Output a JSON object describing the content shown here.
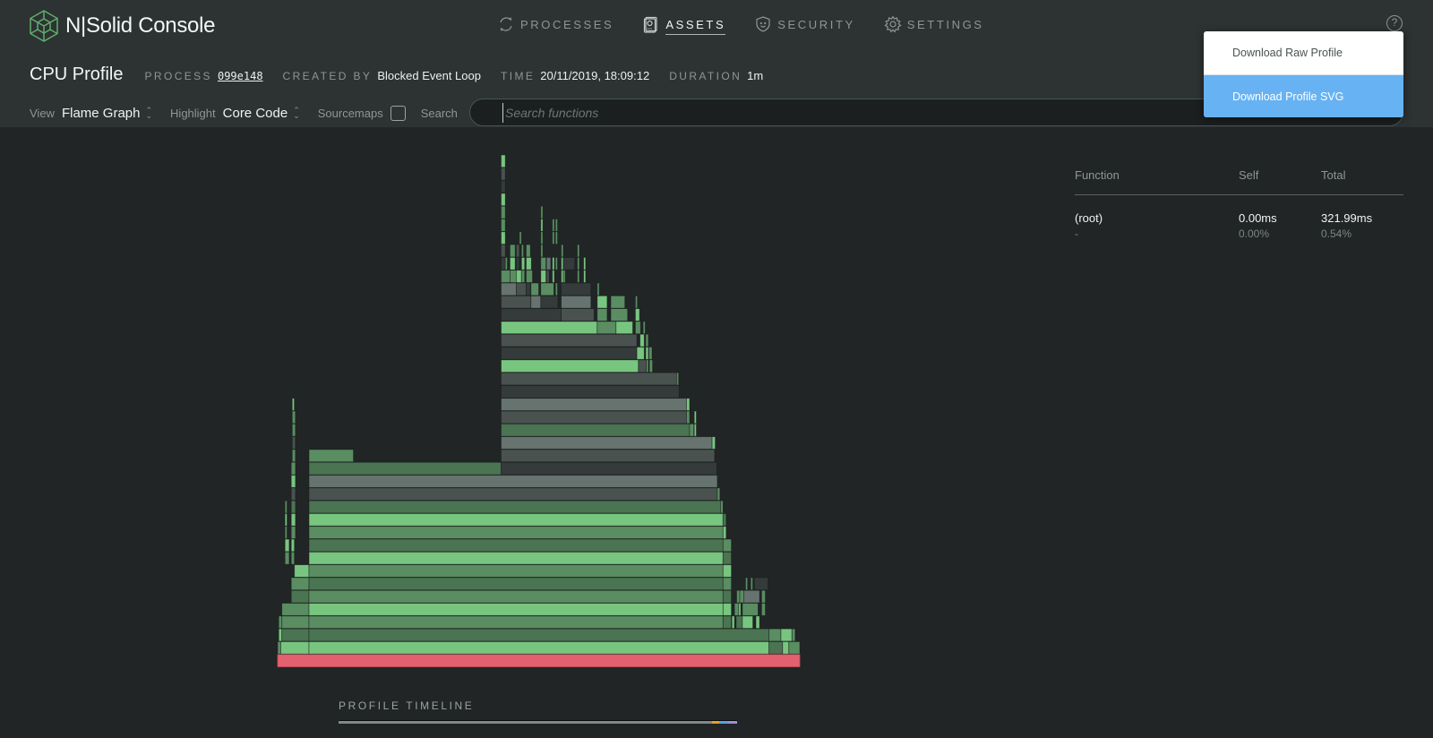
{
  "app": {
    "title": "N|Solid Console"
  },
  "nav": [
    {
      "label": "PROCESSES",
      "icon": "refresh-icon",
      "active": false
    },
    {
      "label": "ASSETS",
      "icon": "assets-icon",
      "active": true
    },
    {
      "label": "SECURITY",
      "icon": "shield-icon",
      "active": false
    },
    {
      "label": "SETTINGS",
      "icon": "gear-icon",
      "active": false
    }
  ],
  "help": {
    "glyph": "?"
  },
  "profile": {
    "title": "CPU Profile",
    "process_label": "PROCESS",
    "process_id": "099e148",
    "created_by_label": "CREATED BY",
    "created_by": "Blocked Event Loop",
    "time_label": "TIME",
    "time": "20/11/2019, 18:09:12",
    "duration_label": "DURATION",
    "duration": "1m"
  },
  "toolbar": {
    "view_label": "View",
    "view_value": "Flame Graph",
    "highlight_label": "Highlight",
    "highlight_value": "Core Code",
    "sourcemaps_label": "Sourcemaps",
    "sourcemaps_checked": false,
    "search_label": "Search",
    "search_placeholder": "Search functions",
    "search_value": ""
  },
  "download_menu": {
    "items": [
      {
        "label": "Download Raw Profile",
        "highlighted": false
      },
      {
        "label": "Download Profile SVG",
        "highlighted": true
      }
    ]
  },
  "function_table": {
    "headers": {
      "function": "Function",
      "self": "Self",
      "total": "Total"
    },
    "rows": [
      {
        "function": "(root)",
        "location": "-",
        "self_time": "0.00ms",
        "self_pct": "0.00%",
        "total_time": "321.99ms",
        "total_pct": "0.54%"
      }
    ]
  },
  "timeline": {
    "label": "PROFILE TIMELINE",
    "segments": [
      {
        "from": 0.0,
        "to": 0.936,
        "color": "#7f8a88"
      },
      {
        "from": 0.936,
        "to": 0.955,
        "color": "#e0a030"
      },
      {
        "from": 0.955,
        "to": 0.978,
        "color": "#5aa0e6"
      },
      {
        "from": 0.978,
        "to": 1.0,
        "color": "#a08cd0"
      }
    ]
  },
  "flame_colors": {
    "root": "#e2616f",
    "light": "#78c57f",
    "mid": "#5a8d62",
    "dark": "#4b7452",
    "gray-light": "#66736f",
    "gray": "#4a5250",
    "gray-dark": "#353b3b"
  },
  "flame_frames": [
    {
      "d": 0,
      "s": 0.0,
      "w": 1.0,
      "c": "root"
    },
    {
      "d": 1,
      "s": 0.0,
      "w": 0.006,
      "c": "mid"
    },
    {
      "d": 1,
      "s": 0.006,
      "w": 0.054,
      "c": "light"
    },
    {
      "d": 1,
      "s": 0.06,
      "w": 0.881,
      "c": "light"
    },
    {
      "d": 1,
      "s": 0.941,
      "w": 0.026,
      "c": "dark"
    },
    {
      "d": 1,
      "s": 0.967,
      "w": 0.012,
      "c": "light"
    },
    {
      "d": 1,
      "s": 0.979,
      "w": 0.021,
      "c": "mid"
    },
    {
      "d": 2,
      "s": 0.002,
      "w": 0.006,
      "c": "light"
    },
    {
      "d": 2,
      "s": 0.008,
      "w": 0.052,
      "c": "dark"
    },
    {
      "d": 2,
      "s": 0.06,
      "w": 0.881,
      "c": "dark"
    },
    {
      "d": 2,
      "s": 0.941,
      "w": 0.023,
      "c": "mid"
    },
    {
      "d": 2,
      "s": 0.964,
      "w": 0.021,
      "c": "light"
    },
    {
      "d": 2,
      "s": 0.985,
      "w": 0.006,
      "c": "mid"
    },
    {
      "d": 3,
      "s": 0.002,
      "w": 0.006,
      "c": "mid"
    },
    {
      "d": 3,
      "s": 0.008,
      "w": 0.052,
      "c": "mid"
    },
    {
      "d": 3,
      "s": 0.06,
      "w": 0.793,
      "c": "mid"
    },
    {
      "d": 3,
      "s": 0.853,
      "w": 0.016,
      "c": "dark"
    },
    {
      "d": 3,
      "s": 0.87,
      "w": 0.005,
      "c": "light"
    },
    {
      "d": 3,
      "s": 0.878,
      "w": 0.012,
      "c": "dark"
    },
    {
      "d": 3,
      "s": 0.89,
      "w": 0.02,
      "c": "light"
    },
    {
      "d": 3,
      "s": 0.916,
      "w": 0.007,
      "c": "light"
    },
    {
      "d": 4,
      "s": 0.008,
      "w": 0.052,
      "c": "mid"
    },
    {
      "d": 4,
      "s": 0.06,
      "w": 0.793,
      "c": "light"
    },
    {
      "d": 4,
      "s": 0.853,
      "w": 0.016,
      "c": "light"
    },
    {
      "d": 4,
      "s": 0.875,
      "w": 0.008,
      "c": "mid"
    },
    {
      "d": 4,
      "s": 0.883,
      "w": 0.004,
      "c": "light"
    },
    {
      "d": 4,
      "s": 0.89,
      "w": 0.03,
      "c": "mid"
    },
    {
      "d": 4,
      "s": 0.927,
      "w": 0.007,
      "c": "mid"
    },
    {
      "d": 5,
      "s": 0.026,
      "w": 0.034,
      "c": "dark"
    },
    {
      "d": 5,
      "s": 0.06,
      "w": 0.793,
      "c": "mid"
    },
    {
      "d": 5,
      "s": 0.853,
      "w": 0.016,
      "c": "dark"
    },
    {
      "d": 5,
      "s": 0.879,
      "w": 0.006,
      "c": "mid"
    },
    {
      "d": 5,
      "s": 0.885,
      "w": 0.008,
      "c": "mid"
    },
    {
      "d": 5,
      "s": 0.893,
      "w": 0.03,
      "c": "gray-light"
    },
    {
      "d": 5,
      "s": 0.927,
      "w": 0.007,
      "c": "mid"
    },
    {
      "d": 6,
      "s": 0.026,
      "w": 0.034,
      "c": "mid"
    },
    {
      "d": 6,
      "s": 0.06,
      "w": 0.793,
      "c": "dark"
    },
    {
      "d": 6,
      "s": 0.853,
      "w": 0.016,
      "c": "mid"
    },
    {
      "d": 6,
      "s": 0.896,
      "w": 0.004,
      "c": "mid"
    },
    {
      "d": 6,
      "s": 0.906,
      "w": 0.004,
      "c": "mid"
    },
    {
      "d": 6,
      "s": 0.913,
      "w": 0.026,
      "c": "gray-dark"
    },
    {
      "d": 7,
      "s": 0.032,
      "w": 0.028,
      "c": "light"
    },
    {
      "d": 7,
      "s": 0.06,
      "w": 0.793,
      "c": "mid"
    },
    {
      "d": 7,
      "s": 0.853,
      "w": 0.016,
      "c": "light"
    },
    {
      "d": 8,
      "s": 0.014,
      "w": 0.008,
      "c": "mid"
    },
    {
      "d": 8,
      "s": 0.026,
      "w": 0.006,
      "c": "mid"
    },
    {
      "d": 8,
      "s": 0.06,
      "w": 0.793,
      "c": "light"
    },
    {
      "d": 8,
      "s": 0.853,
      "w": 0.016,
      "c": "dark"
    },
    {
      "d": 9,
      "s": 0.014,
      "w": 0.008,
      "c": "light"
    },
    {
      "d": 9,
      "s": 0.026,
      "w": 0.006,
      "c": "light"
    },
    {
      "d": 9,
      "s": 0.06,
      "w": 0.793,
      "c": "dark"
    },
    {
      "d": 9,
      "s": 0.853,
      "w": 0.016,
      "c": "mid"
    },
    {
      "d": 10,
      "s": 0.014,
      "w": 0.004,
      "c": "mid"
    },
    {
      "d": 10,
      "s": 0.026,
      "w": 0.008,
      "c": "mid"
    },
    {
      "d": 10,
      "s": 0.06,
      "w": 0.793,
      "c": "mid"
    },
    {
      "d": 10,
      "s": 0.853,
      "w": 0.006,
      "c": "light"
    },
    {
      "d": 11,
      "s": 0.014,
      "w": 0.004,
      "c": "light"
    },
    {
      "d": 11,
      "s": 0.026,
      "w": 0.008,
      "c": "light"
    },
    {
      "d": 11,
      "s": 0.06,
      "w": 0.793,
      "c": "light"
    },
    {
      "d": 11,
      "s": 0.853,
      "w": 0.006,
      "c": "dark"
    },
    {
      "d": 12,
      "s": 0.014,
      "w": 0.004,
      "c": "mid"
    },
    {
      "d": 12,
      "s": 0.026,
      "w": 0.008,
      "c": "dark"
    },
    {
      "d": 12,
      "s": 0.06,
      "w": 0.788,
      "c": "dark"
    },
    {
      "d": 12,
      "s": 0.848,
      "w": 0.005,
      "c": "mid"
    },
    {
      "d": 13,
      "s": 0.026,
      "w": 0.008,
      "c": "gray"
    },
    {
      "d": 13,
      "s": 0.06,
      "w": 0.782,
      "c": "gray"
    },
    {
      "d": 13,
      "s": 0.842,
      "w": 0.005,
      "c": "mid"
    },
    {
      "d": 14,
      "s": 0.026,
      "w": 0.008,
      "c": "light"
    },
    {
      "d": 14,
      "s": 0.06,
      "w": 0.782,
      "c": "gray-light"
    },
    {
      "d": 15,
      "s": 0.026,
      "w": 0.008,
      "c": "mid"
    },
    {
      "d": 15,
      "s": 0.06,
      "w": 0.368,
      "c": "dark"
    },
    {
      "d": 15,
      "s": 0.428,
      "w": 0.413,
      "c": "gray-dark"
    },
    {
      "d": 16,
      "s": 0.028,
      "w": 0.006,
      "c": "mid"
    },
    {
      "d": 16,
      "s": 0.06,
      "w": 0.085,
      "c": "mid"
    },
    {
      "d": 16,
      "s": 0.428,
      "w": 0.409,
      "c": "gray"
    },
    {
      "d": 17,
      "s": 0.028,
      "w": 0.006,
      "c": "gray"
    },
    {
      "d": 17,
      "s": 0.428,
      "w": 0.404,
      "c": "gray-light"
    },
    {
      "d": 17,
      "s": 0.832,
      "w": 0.006,
      "c": "light"
    },
    {
      "d": 18,
      "s": 0.028,
      "w": 0.006,
      "c": "mid"
    },
    {
      "d": 18,
      "s": 0.428,
      "w": 0.361,
      "c": "dark"
    },
    {
      "d": 18,
      "s": 0.789,
      "w": 0.008,
      "c": "mid"
    },
    {
      "d": 18,
      "s": 0.798,
      "w": 0.004,
      "c": "light"
    },
    {
      "d": 19,
      "s": 0.028,
      "w": 0.006,
      "c": "mid"
    },
    {
      "d": 19,
      "s": 0.428,
      "w": 0.355,
      "c": "gray"
    },
    {
      "d": 19,
      "s": 0.783,
      "w": 0.006,
      "c": "mid"
    },
    {
      "d": 19,
      "s": 0.798,
      "w": 0.004,
      "c": "light"
    },
    {
      "d": 20,
      "s": 0.028,
      "w": 0.004,
      "c": "light"
    },
    {
      "d": 20,
      "s": 0.428,
      "w": 0.355,
      "c": "gray-light"
    },
    {
      "d": 20,
      "s": 0.783,
      "w": 0.006,
      "c": "light"
    },
    {
      "d": 21,
      "s": 0.428,
      "w": 0.341,
      "c": "gray-dark"
    },
    {
      "d": 22,
      "s": 0.428,
      "w": 0.336,
      "c": "gray"
    },
    {
      "d": 22,
      "s": 0.764,
      "w": 0.004,
      "c": "mid"
    },
    {
      "d": 23,
      "s": 0.428,
      "w": 0.263,
      "c": "light"
    },
    {
      "d": 23,
      "s": 0.691,
      "w": 0.015,
      "c": "gray"
    },
    {
      "d": 23,
      "s": 0.706,
      "w": 0.004,
      "c": "mid"
    },
    {
      "d": 23,
      "s": 0.712,
      "w": 0.006,
      "c": "mid"
    },
    {
      "d": 24,
      "s": 0.428,
      "w": 0.26,
      "c": "gray-dark"
    },
    {
      "d": 24,
      "s": 0.688,
      "w": 0.014,
      "c": "light"
    },
    {
      "d": 24,
      "s": 0.705,
      "w": 0.005,
      "c": "light"
    },
    {
      "d": 24,
      "s": 0.711,
      "w": 0.006,
      "c": "mid"
    },
    {
      "d": 25,
      "s": 0.428,
      "w": 0.26,
      "c": "gray"
    },
    {
      "d": 25,
      "s": 0.694,
      "w": 0.008,
      "c": "light"
    },
    {
      "d": 25,
      "s": 0.705,
      "w": 0.005,
      "c": "mid"
    },
    {
      "d": 26,
      "s": 0.428,
      "w": 0.184,
      "c": "light"
    },
    {
      "d": 26,
      "s": 0.612,
      "w": 0.036,
      "c": "mid"
    },
    {
      "d": 26,
      "s": 0.648,
      "w": 0.032,
      "c": "light"
    },
    {
      "d": 26,
      "s": 0.685,
      "w": 0.01,
      "c": "mid"
    },
    {
      "d": 26,
      "s": 0.7,
      "w": 0.004,
      "c": "mid"
    },
    {
      "d": 27,
      "s": 0.428,
      "w": 0.115,
      "c": "gray-dark"
    },
    {
      "d": 27,
      "s": 0.543,
      "w": 0.063,
      "c": "gray"
    },
    {
      "d": 27,
      "s": 0.612,
      "w": 0.019,
      "c": "mid"
    },
    {
      "d": 27,
      "s": 0.638,
      "w": 0.032,
      "c": "mid"
    },
    {
      "d": 27,
      "s": 0.685,
      "w": 0.008,
      "c": "light"
    },
    {
      "d": 28,
      "s": 0.428,
      "w": 0.057,
      "c": "gray"
    },
    {
      "d": 28,
      "s": 0.485,
      "w": 0.019,
      "c": "gray-light"
    },
    {
      "d": 28,
      "s": 0.504,
      "w": 0.033,
      "c": "gray-dark"
    },
    {
      "d": 28,
      "s": 0.543,
      "w": 0.057,
      "c": "gray-light"
    },
    {
      "d": 28,
      "s": 0.612,
      "w": 0.019,
      "c": "light"
    },
    {
      "d": 28,
      "s": 0.638,
      "w": 0.027,
      "c": "mid"
    },
    {
      "d": 28,
      "s": 0.685,
      "w": 0.004,
      "c": "mid"
    },
    {
      "d": 29,
      "s": 0.428,
      "w": 0.029,
      "c": "gray-light"
    },
    {
      "d": 29,
      "s": 0.457,
      "w": 0.019,
      "c": "gray"
    },
    {
      "d": 29,
      "s": 0.476,
      "w": 0.008,
      "c": "gray-dark"
    },
    {
      "d": 29,
      "s": 0.485,
      "w": 0.015,
      "c": "mid"
    },
    {
      "d": 29,
      "s": 0.504,
      "w": 0.025,
      "c": "mid"
    },
    {
      "d": 29,
      "s": 0.532,
      "w": 0.004,
      "c": "mid"
    },
    {
      "d": 29,
      "s": 0.543,
      "w": 0.057,
      "c": "gray-dark"
    },
    {
      "d": 29,
      "s": 0.612,
      "w": 0.004,
      "c": "mid"
    },
    {
      "d": 30,
      "s": 0.428,
      "w": 0.017,
      "c": "mid"
    },
    {
      "d": 30,
      "s": 0.445,
      "w": 0.012,
      "c": "mid"
    },
    {
      "d": 30,
      "s": 0.457,
      "w": 0.01,
      "c": "light"
    },
    {
      "d": 30,
      "s": 0.467,
      "w": 0.006,
      "c": "mid"
    },
    {
      "d": 30,
      "s": 0.476,
      "w": 0.012,
      "c": "mid"
    },
    {
      "d": 30,
      "s": 0.504,
      "w": 0.01,
      "c": "light"
    },
    {
      "d": 30,
      "s": 0.515,
      "w": 0.005,
      "c": "gray"
    },
    {
      "d": 30,
      "s": 0.526,
      "w": 0.004,
      "c": "light"
    },
    {
      "d": 30,
      "s": 0.543,
      "w": 0.004,
      "c": "light"
    },
    {
      "d": 30,
      "s": 0.547,
      "w": 0.004,
      "c": "mid"
    },
    {
      "d": 30,
      "s": 0.574,
      "w": 0.004,
      "c": "mid"
    },
    {
      "d": 30,
      "s": 0.586,
      "w": 0.004,
      "c": "light"
    },
    {
      "d": 31,
      "s": 0.428,
      "w": 0.008,
      "c": "gray-dark"
    },
    {
      "d": 31,
      "s": 0.436,
      "w": 0.004,
      "c": "mid"
    },
    {
      "d": 31,
      "s": 0.445,
      "w": 0.01,
      "c": "light"
    },
    {
      "d": 31,
      "s": 0.457,
      "w": 0.006,
      "c": "gray-dark"
    },
    {
      "d": 31,
      "s": 0.467,
      "w": 0.006,
      "c": "light"
    },
    {
      "d": 31,
      "s": 0.476,
      "w": 0.01,
      "c": "light"
    },
    {
      "d": 31,
      "s": 0.504,
      "w": 0.01,
      "c": "mid"
    },
    {
      "d": 31,
      "s": 0.515,
      "w": 0.008,
      "c": "gray-light"
    },
    {
      "d": 31,
      "s": 0.526,
      "w": 0.004,
      "c": "light"
    },
    {
      "d": 31,
      "s": 0.532,
      "w": 0.004,
      "c": "mid"
    },
    {
      "d": 31,
      "s": 0.543,
      "w": 0.004,
      "c": "light"
    },
    {
      "d": 31,
      "s": 0.547,
      "w": 0.022,
      "c": "gray-dark"
    },
    {
      "d": 31,
      "s": 0.574,
      "w": 0.004,
      "c": "mid"
    },
    {
      "d": 31,
      "s": 0.586,
      "w": 0.004,
      "c": "light"
    },
    {
      "d": 32,
      "s": 0.428,
      "w": 0.008,
      "c": "gray"
    },
    {
      "d": 32,
      "s": 0.445,
      "w": 0.01,
      "c": "mid"
    },
    {
      "d": 32,
      "s": 0.457,
      "w": 0.006,
      "c": "gray"
    },
    {
      "d": 32,
      "s": 0.467,
      "w": 0.004,
      "c": "mid"
    },
    {
      "d": 32,
      "s": 0.476,
      "w": 0.008,
      "c": "mid"
    },
    {
      "d": 32,
      "s": 0.504,
      "w": 0.004,
      "c": "mid"
    },
    {
      "d": 32,
      "s": 0.543,
      "w": 0.004,
      "c": "mid"
    },
    {
      "d": 32,
      "s": 0.574,
      "w": 0.004,
      "c": "mid"
    },
    {
      "d": 33,
      "s": 0.428,
      "w": 0.008,
      "c": "light"
    },
    {
      "d": 33,
      "s": 0.463,
      "w": 0.004,
      "c": "mid"
    },
    {
      "d": 33,
      "s": 0.504,
      "w": 0.004,
      "c": "mid"
    },
    {
      "d": 33,
      "s": 0.526,
      "w": 0.004,
      "c": "mid"
    },
    {
      "d": 33,
      "s": 0.532,
      "w": 0.004,
      "c": "mid"
    },
    {
      "d": 34,
      "s": 0.428,
      "w": 0.008,
      "c": "mid"
    },
    {
      "d": 34,
      "s": 0.504,
      "w": 0.004,
      "c": "light"
    },
    {
      "d": 34,
      "s": 0.526,
      "w": 0.004,
      "c": "mid"
    },
    {
      "d": 34,
      "s": 0.532,
      "w": 0.004,
      "c": "mid"
    },
    {
      "d": 35,
      "s": 0.428,
      "w": 0.008,
      "c": "mid"
    },
    {
      "d": 35,
      "s": 0.504,
      "w": 0.004,
      "c": "mid"
    },
    {
      "d": 36,
      "s": 0.428,
      "w": 0.008,
      "c": "light"
    },
    {
      "d": 37,
      "s": 0.428,
      "w": 0.008,
      "c": "gray-dark"
    },
    {
      "d": 38,
      "s": 0.428,
      "w": 0.008,
      "c": "gray"
    },
    {
      "d": 39,
      "s": 0.428,
      "w": 0.008,
      "c": "light"
    }
  ]
}
